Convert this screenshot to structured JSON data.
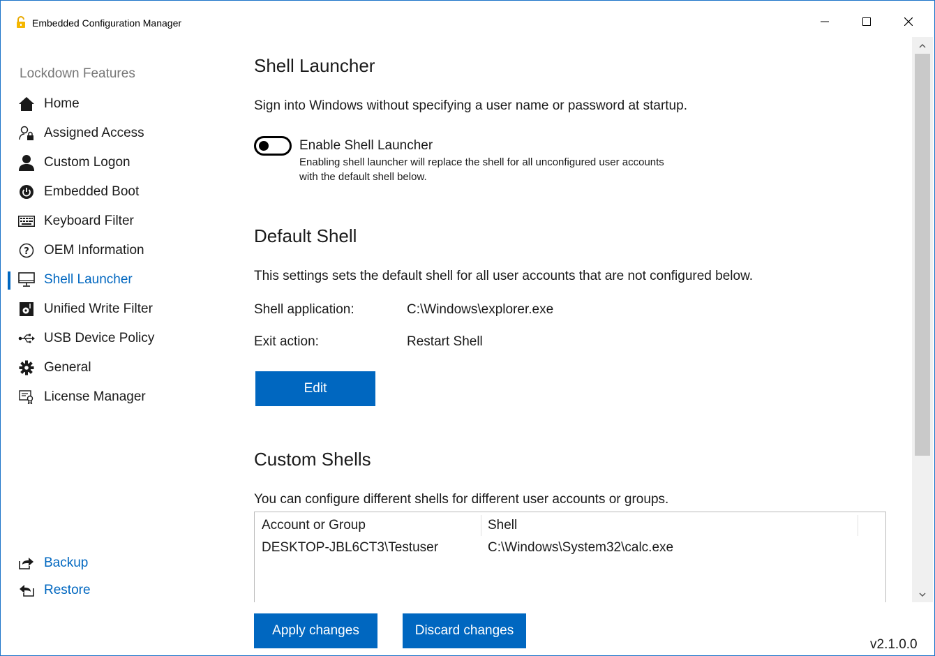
{
  "window": {
    "title": "Embedded Configuration Manager",
    "accent_color": "#0067c0",
    "controls": [
      "minimize-icon",
      "maximize-icon",
      "close-icon"
    ]
  },
  "sidebar": {
    "heading": "Lockdown Features",
    "items": [
      {
        "label": "Home",
        "icon": "home-icon"
      },
      {
        "label": "Assigned Access",
        "icon": "user-lock-icon"
      },
      {
        "label": "Custom Logon",
        "icon": "user-icon"
      },
      {
        "label": "Embedded Boot",
        "icon": "power-icon"
      },
      {
        "label": "Keyboard Filter",
        "icon": "keyboard-icon"
      },
      {
        "label": "OEM Information",
        "icon": "help-icon"
      },
      {
        "label": "Shell Launcher",
        "icon": "monitor-icon",
        "active": true
      },
      {
        "label": "Unified Write Filter",
        "icon": "disk-icon"
      },
      {
        "label": "USB Device Policy",
        "icon": "usb-icon"
      },
      {
        "label": "General",
        "icon": "gear-icon"
      },
      {
        "label": "License Manager",
        "icon": "license-icon"
      }
    ],
    "links": [
      {
        "label": "Backup",
        "icon": "backup-icon"
      },
      {
        "label": "Restore",
        "icon": "restore-icon"
      }
    ]
  },
  "main": {
    "shell_launcher": {
      "title": "Shell Launcher",
      "description": "Sign into Windows without specifying a user name or password at startup.",
      "toggle_label": "Enable Shell Launcher",
      "toggle_on": false,
      "toggle_help_line1": "Enabling shell launcher will replace the shell for all unconfigured user accounts",
      "toggle_help_line2": "with the default shell below."
    },
    "default_shell": {
      "title": "Default Shell",
      "description": "This settings sets the default shell for all user accounts that are not configured below.",
      "app_label": "Shell application:",
      "app_value": "C:\\Windows\\explorer.exe",
      "exit_label": "Exit action:",
      "exit_value": "Restart Shell",
      "edit_label": "Edit"
    },
    "custom_shells": {
      "title": "Custom Shells",
      "description": "You can configure different shells for different user accounts or groups.",
      "columns": [
        "Account or Group",
        "Shell"
      ],
      "rows": [
        {
          "account": "DESKTOP-JBL6CT3\\Testuser",
          "shell": "C:\\Windows\\System32\\calc.exe"
        }
      ]
    },
    "apply_label": "Apply changes",
    "discard_label": "Discard changes"
  },
  "version": "v2.1.0.0"
}
